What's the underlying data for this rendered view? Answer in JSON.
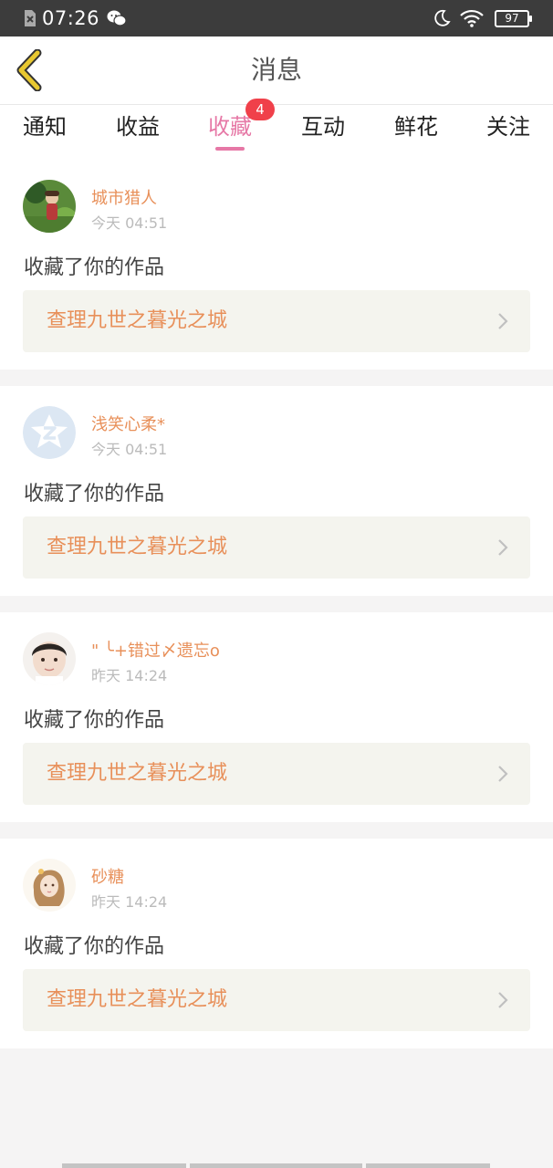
{
  "status_bar": {
    "time": "07:26",
    "battery": "97",
    "icons": [
      "sim-icon",
      "wechat-icon",
      "moon-icon",
      "wifi-icon",
      "battery-icon"
    ]
  },
  "header": {
    "title": "消息",
    "back_icon": "chevron-left-icon",
    "back_color": "#e8c830"
  },
  "tabs": [
    {
      "label": "通知"
    },
    {
      "label": "收益"
    },
    {
      "label": "收藏",
      "badge": "4",
      "active": true
    },
    {
      "label": "互动"
    },
    {
      "label": "鲜花"
    },
    {
      "label": "关注"
    }
  ],
  "colors": {
    "accent": "#e678a6",
    "name": "#e8905a",
    "badge": "#f0404a"
  },
  "cards": [
    {
      "user": "城市猎人",
      "time": "今天 04:51",
      "action": "收藏了你的作品",
      "work": "查理九世之暮光之城",
      "avatar": "avatar-game-character"
    },
    {
      "user": "浅笑心柔*",
      "time": "今天 04:51",
      "action": "收藏了你的作品",
      "work": "查理九世之暮光之城",
      "avatar": "avatar-default-z-icon"
    },
    {
      "user": "\" ╰+错过〆遗忘o",
      "time": "昨天 14:24",
      "action": "收藏了你的作品",
      "work": "查理九世之暮光之城",
      "avatar": "avatar-child-photo"
    },
    {
      "user": "砂糖",
      "time": "昨天 14:24",
      "action": "收藏了你的作品",
      "work": "查理九世之暮光之城",
      "avatar": "avatar-girl-illustration"
    }
  ]
}
